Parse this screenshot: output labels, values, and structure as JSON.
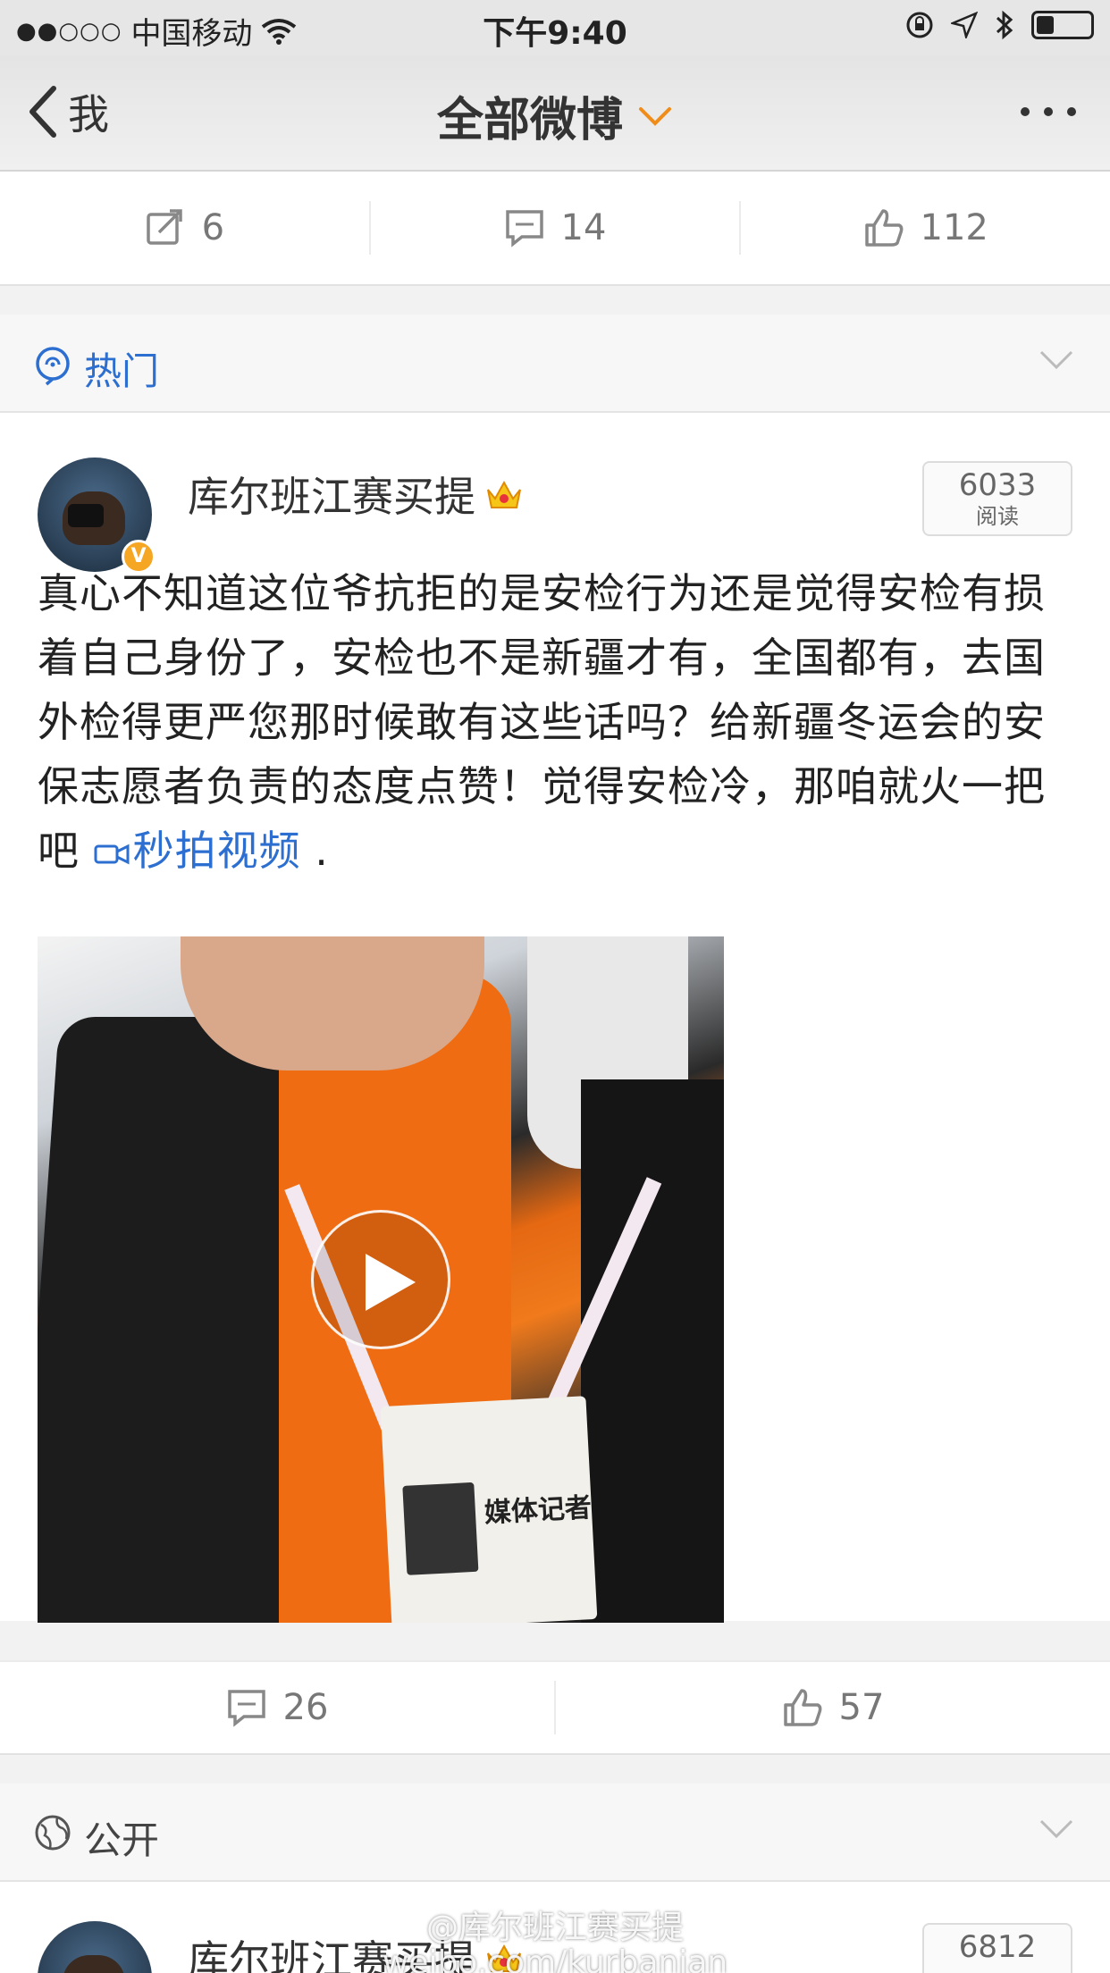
{
  "status_bar": {
    "signal": "●●○○○",
    "carrier": "中国移动",
    "time": "下午9:40"
  },
  "nav": {
    "back_label": "我",
    "title": "全部微博"
  },
  "prev_post_actions": {
    "reposts": "6",
    "comments": "14",
    "likes": "112"
  },
  "hot_section": {
    "label": "热门"
  },
  "post": {
    "author": "库尔班江赛买提",
    "reads_count": "6033",
    "reads_label": "阅读",
    "text": "真心不知道这位爷抗拒的是安检行为还是觉得安检有损着自己身份了，安检也不是新疆才有，全国都有，去国外检得更严您那时候敢有这些话吗？给新疆冬运会的安保志愿者负责的态度点赞！觉得安检冷，那咱就火一把吧 ",
    "video_link": "秒拍视频",
    "text_end": " .",
    "video_badge_text": "媒体记者",
    "comments": "26",
    "likes": "57"
  },
  "public_section": {
    "label": "公开"
  },
  "next_post": {
    "author": "库尔班江赛买提",
    "reads_count": "6812"
  },
  "watermark": {
    "line1": "@库尔班江赛买提",
    "line2": "weibo.com/kurbanjan"
  },
  "colors": {
    "link": "#2c6fd1",
    "accent_orange": "#f08c1a",
    "verified": "#f5a623"
  }
}
